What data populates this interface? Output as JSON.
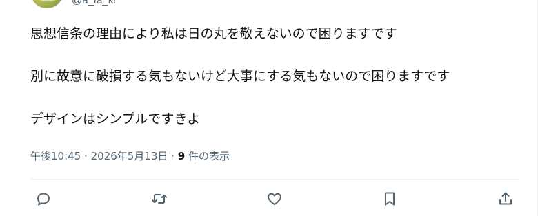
{
  "author": {
    "handle": "@a_ta_ki"
  },
  "tweet": {
    "lines": [
      "思想信条の理由により私は日の丸を敬えないので困りますです",
      "別に故意に破損する気もないけど大事にする気もないので困りますです",
      "デザインはシンプルですきよ"
    ]
  },
  "meta": {
    "time": "午後10:45",
    "separator": "·",
    "date": "2026年5月13日",
    "views_count": "9",
    "views_label": "件の表示"
  },
  "actions": [
    {
      "name": "reply-button",
      "icon": "reply-icon"
    },
    {
      "name": "retweet-button",
      "icon": "retweet-icon"
    },
    {
      "name": "like-button",
      "icon": "heart-icon"
    },
    {
      "name": "bookmark-button",
      "icon": "bookmark-icon"
    },
    {
      "name": "share-button",
      "icon": "share-icon"
    }
  ],
  "colors": {
    "text": "#0f1419",
    "secondary": "#536471",
    "border": "#eff3f4"
  }
}
